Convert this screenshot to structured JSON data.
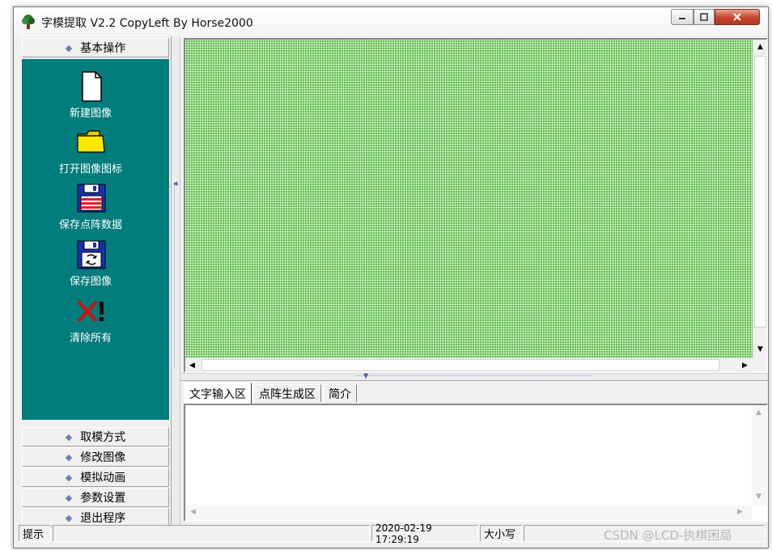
{
  "window": {
    "title": "字模提取 V2.2  CopyLeft By Horse2000"
  },
  "left_panel": {
    "top_category": "基本操作",
    "tools": [
      {
        "label": "新建图像",
        "icon": "new-document-icon"
      },
      {
        "label": "打开图像图标",
        "icon": "open-folder-icon"
      },
      {
        "label": "保存点阵数据",
        "icon": "save-dot-data-icon"
      },
      {
        "label": "保存图像",
        "icon": "save-image-icon"
      },
      {
        "label": "清除所有",
        "icon": "clear-all-icon"
      }
    ],
    "bottom_categories": [
      "取模方式",
      "修改图像",
      "模拟动画",
      "参数设置",
      "退出程序"
    ]
  },
  "tabs": [
    "文字输入区",
    "点阵生成区",
    "简介"
  ],
  "active_tab": 0,
  "text_area": {
    "value": ""
  },
  "status": {
    "hint_label": "提示",
    "hint_text": "",
    "datetime": "2020-02-19 17:29:19",
    "caps": "大小写"
  },
  "watermark": "CSDN @LCD-执棋困局",
  "colors": {
    "panel_teal": "#007c7c",
    "grid_green": "#5fbf4a",
    "chrome": "#f0f0f0"
  }
}
